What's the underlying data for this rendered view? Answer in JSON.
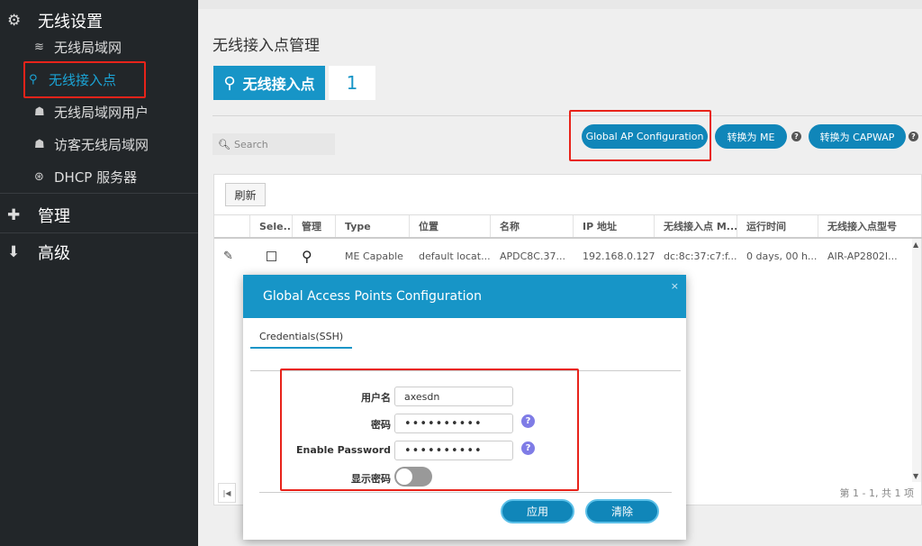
{
  "sidebar": {
    "wireless": {
      "label": "无线设置",
      "icon": "gear-icon"
    },
    "items": [
      {
        "label": "无线局域网",
        "icon": "rss-icon"
      },
      {
        "label": "无线接入点",
        "icon": "access-point-icon"
      },
      {
        "label": "无线局域网用户",
        "icon": "users-icon"
      },
      {
        "label": "访客无线局域网",
        "icon": "users-icon"
      },
      {
        "label": "DHCP 服务器",
        "icon": "dhcp-icon"
      }
    ],
    "manage": {
      "label": "管理",
      "icon": "puzzle-icon"
    },
    "advanced": {
      "label": "高级",
      "icon": "download-icon"
    }
  },
  "main": {
    "title": "无线接入点管理",
    "badge_label": "无线接入点",
    "badge_count": "1",
    "search_placeholder": "Search",
    "buttons": {
      "global_ap": "Global AP Configuration",
      "convert_me": "转换为 ME",
      "convert_capwap": "转换为 CAPWAP"
    },
    "refresh": "刷新",
    "columns": [
      "Sele...",
      "管理",
      "Type",
      "位置",
      "名称",
      "IP 地址",
      "无线接入点 M...",
      "运行时间",
      "无线接入点型号"
    ],
    "row": {
      "type": "ME Capable",
      "location": "default locat...",
      "name": "APDC8C.37...",
      "ip": "192.168.0.127",
      "mac": "dc:8c:37:c7:f...",
      "uptime": "0 days, 00 h...",
      "model": "AIR-AP2802I..."
    },
    "pager_text": "第 1 - 1, 共 1 项"
  },
  "modal": {
    "title": "Global Access Points Configuration",
    "tab": "Credentials(SSH)",
    "username_label": "用户名",
    "username_value": "axesdn",
    "password_label": "密码",
    "password_value": "••••••••••",
    "enable_label": "Enable Password",
    "enable_value": "••••••••••",
    "show_label": "显示密码",
    "apply": "应用",
    "clear": "清除",
    "close": "×"
  },
  "colors": {
    "accent": "#1795c7",
    "button": "#1086b9",
    "highlight_box": "#e8231a",
    "sidebar_bg": "#222629"
  }
}
